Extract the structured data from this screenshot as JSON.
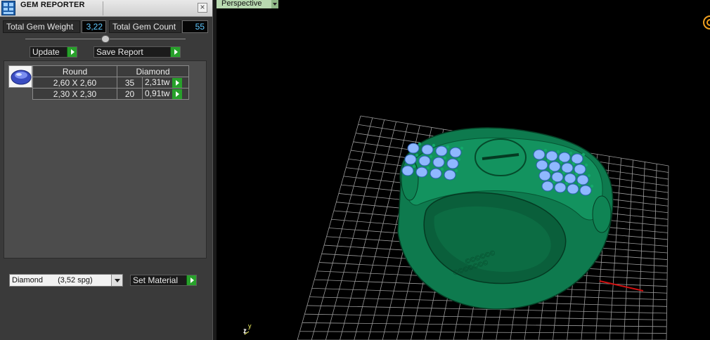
{
  "panel": {
    "title": "GEM REPORTER",
    "total_weight_label": "Total Gem Weight",
    "total_weight_value": "3,22",
    "total_count_label": "Total Gem Count",
    "total_count_value": "55",
    "update_label": "Update",
    "save_report_label": "Save Report",
    "table": {
      "headers": [
        "Round",
        "Diamond"
      ],
      "rows": [
        {
          "size": "2,60 X 2,60",
          "count": "35",
          "weight": "2,31tw"
        },
        {
          "size": "2,30 X 2,30",
          "count": "20",
          "weight": "0,91tw"
        }
      ]
    },
    "material": {
      "name": "Diamond",
      "sg": "(3,52 spg)"
    },
    "set_material_label": "Set Material"
  },
  "viewport": {
    "view_name": "Perspective",
    "axis_labels": {
      "z": "z",
      "y": "y"
    },
    "grid_color": "#9a9a9a",
    "ring_color": "#0e7a4e",
    "gem_color": "#8fb8ff",
    "x_axis_color": "#d01010",
    "y_axis_color": "#12b5c9"
  }
}
